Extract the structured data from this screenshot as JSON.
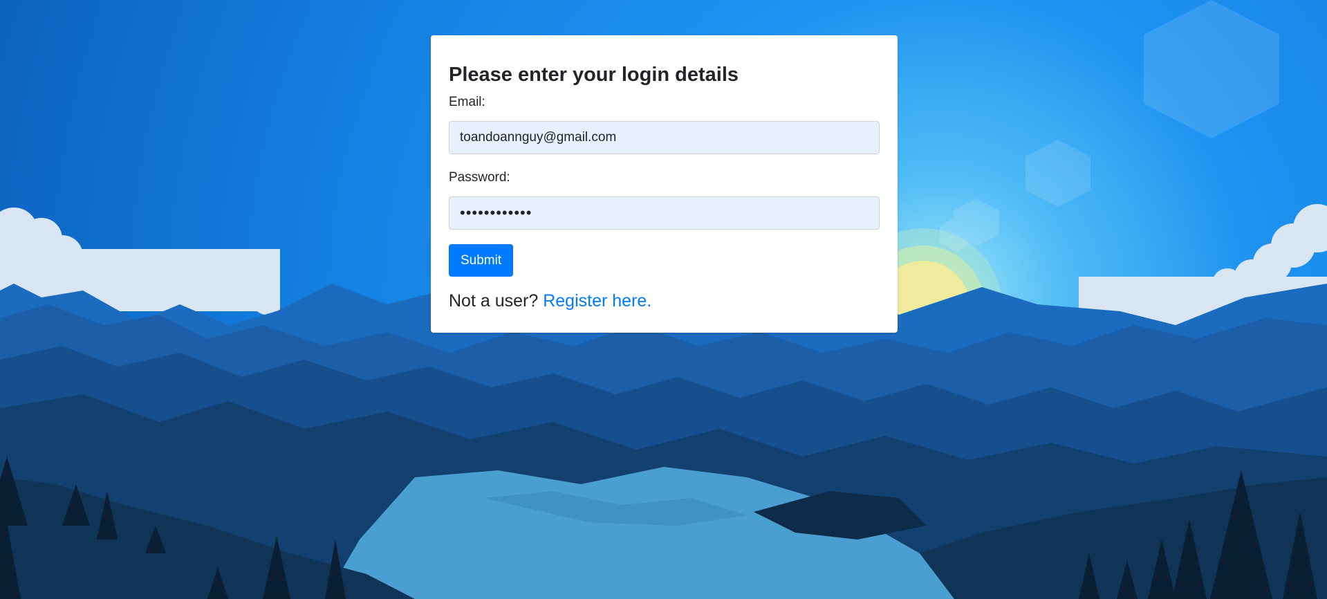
{
  "login_form": {
    "heading": "Please enter your login details",
    "email_label": "Email:",
    "email_value": "toandoannguy@gmail.com",
    "password_label": "Password:",
    "password_value": "••••••••••••",
    "submit_label": "Submit",
    "register_prompt": "Not a user?",
    "register_link": "Register here."
  },
  "colors": {
    "accent": "#007bff",
    "input_bg": "#e8f0fe",
    "sky_top": "#1277d8",
    "sky_mid": "#2a9af5"
  }
}
